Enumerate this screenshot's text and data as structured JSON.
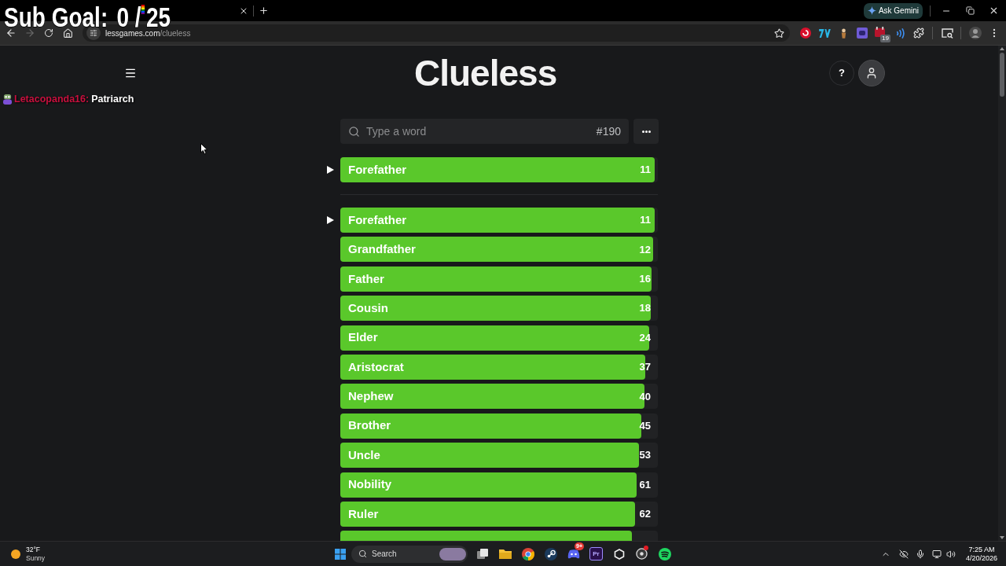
{
  "overlay": {
    "sub_goal": {
      "label": "Sub Goal:",
      "count": "0 /",
      "goal": "25"
    },
    "chat": {
      "user": "Letacopanda16:",
      "message": "Patriarch"
    }
  },
  "browser": {
    "gemini_button": "Ask Gemini",
    "nav": {
      "back_disabled": false,
      "forward_disabled": true
    },
    "url": {
      "host": "lessgames.com",
      "path": "/clueless"
    },
    "extension_badge": "19"
  },
  "page": {
    "title": "Clueless",
    "help_button": "?",
    "search": {
      "placeholder": "Type a word",
      "puzzle_number": "#190"
    },
    "latest_guess": {
      "word": "Forefather",
      "rank": "11",
      "level": 0.99,
      "marked": true
    },
    "guesses": [
      {
        "word": "Forefather",
        "rank": "11",
        "level": 0.99,
        "marked": true
      },
      {
        "word": "Grandfather",
        "rank": "12",
        "level": 0.985,
        "marked": false
      },
      {
        "word": "Father",
        "rank": "16",
        "level": 0.98,
        "marked": false
      },
      {
        "word": "Cousin",
        "rank": "18",
        "level": 0.978,
        "marked": false
      },
      {
        "word": "Elder",
        "rank": "24",
        "level": 0.974,
        "marked": false
      },
      {
        "word": "Aristocrat",
        "rank": "37",
        "level": 0.96,
        "marked": false
      },
      {
        "word": "Nephew",
        "rank": "40",
        "level": 0.957,
        "marked": false
      },
      {
        "word": "Brother",
        "rank": "45",
        "level": 0.948,
        "marked": false
      },
      {
        "word": "Uncle",
        "rank": "53",
        "level": 0.94,
        "marked": false
      },
      {
        "word": "Nobility",
        "rank": "61",
        "level": 0.932,
        "marked": false
      },
      {
        "word": "Ruler",
        "rank": "62",
        "level": 0.929,
        "marked": false
      },
      {
        "level": 0.918,
        "marked": false
      }
    ]
  },
  "taskbar": {
    "weather": {
      "temperature": "32°F",
      "condition": "Sunny"
    },
    "search_label": "Search",
    "discord_badge": "9+",
    "premiere_label": "Pr",
    "time": "7:25 AM",
    "date": "4/20/2026"
  }
}
